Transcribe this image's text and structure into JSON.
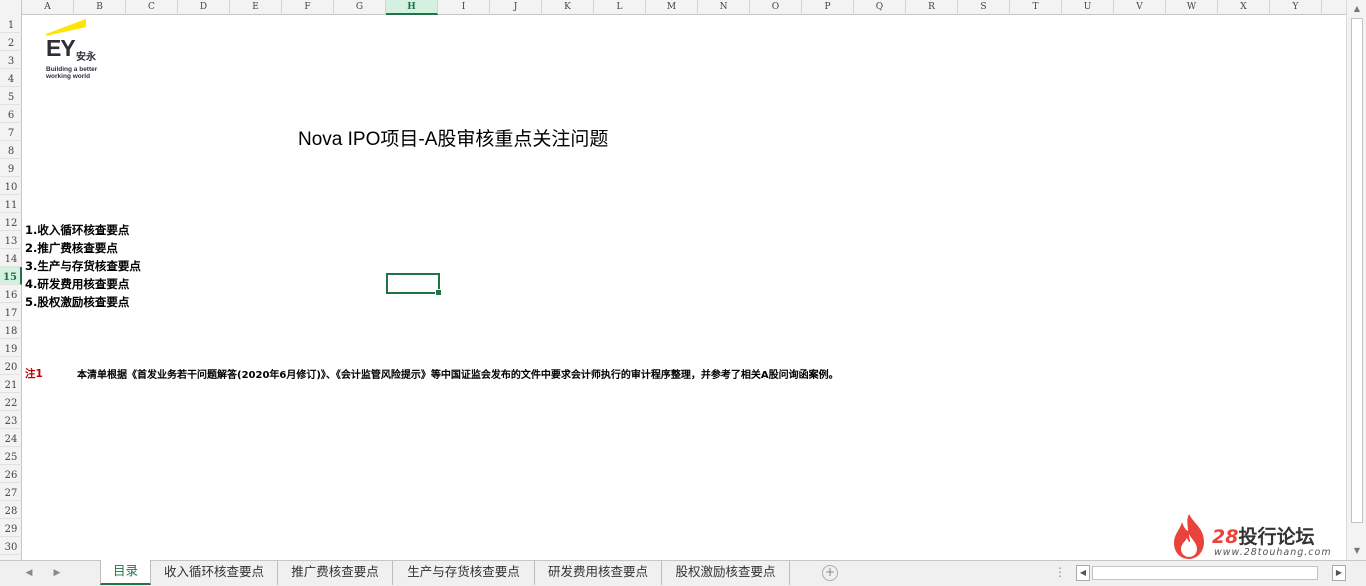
{
  "columns": [
    "A",
    "B",
    "C",
    "D",
    "E",
    "F",
    "G",
    "H",
    "I",
    "J",
    "K",
    "L",
    "M",
    "N",
    "O",
    "P",
    "Q",
    "R",
    "S",
    "T",
    "U",
    "V",
    "W",
    "X",
    "Y"
  ],
  "active_column": "H",
  "rows": [
    "1",
    "2",
    "3",
    "4",
    "5",
    "6",
    "7",
    "8",
    "9",
    "10",
    "11",
    "12",
    "13",
    "14",
    "15",
    "16",
    "17",
    "18",
    "19",
    "20",
    "21",
    "22",
    "23",
    "24",
    "25",
    "26",
    "27",
    "28",
    "29",
    "30"
  ],
  "active_row": "15",
  "logo": {
    "brand": "EY",
    "chinese": "安永",
    "tagline_1": "Building a better",
    "tagline_2": "working world",
    "accent_color": "#ffe600"
  },
  "title": "Nova IPO项目-A股审核重点关注问题",
  "toc": [
    "1.收入循环核查要点",
    "2.推广费核查要点",
    "3.生产与存货核查要点",
    "4.研发费用核查要点",
    "5.股权激励核查要点"
  ],
  "note": {
    "label": "注1",
    "text": "本清单根据《首发业务若干问题解答(2020年6月修订)》、《会计监管风险提示》等中国证监会发布的文件中要求会计师执行的审计程序整理，并参考了相关A股问询函案例。"
  },
  "tabs": [
    "目录",
    "收入循环核查要点",
    "推广费核查要点",
    "生产与存货核查要点",
    "研发费用核查要点",
    "股权激励核查要点"
  ],
  "active_tab": "目录",
  "watermark": {
    "number": "28",
    "name": "投行论坛",
    "url": "www.28touhang.com"
  },
  "colors": {
    "excel_green": "#217346",
    "note_red": "#c00000",
    "watermark_red": "#e8443b"
  }
}
